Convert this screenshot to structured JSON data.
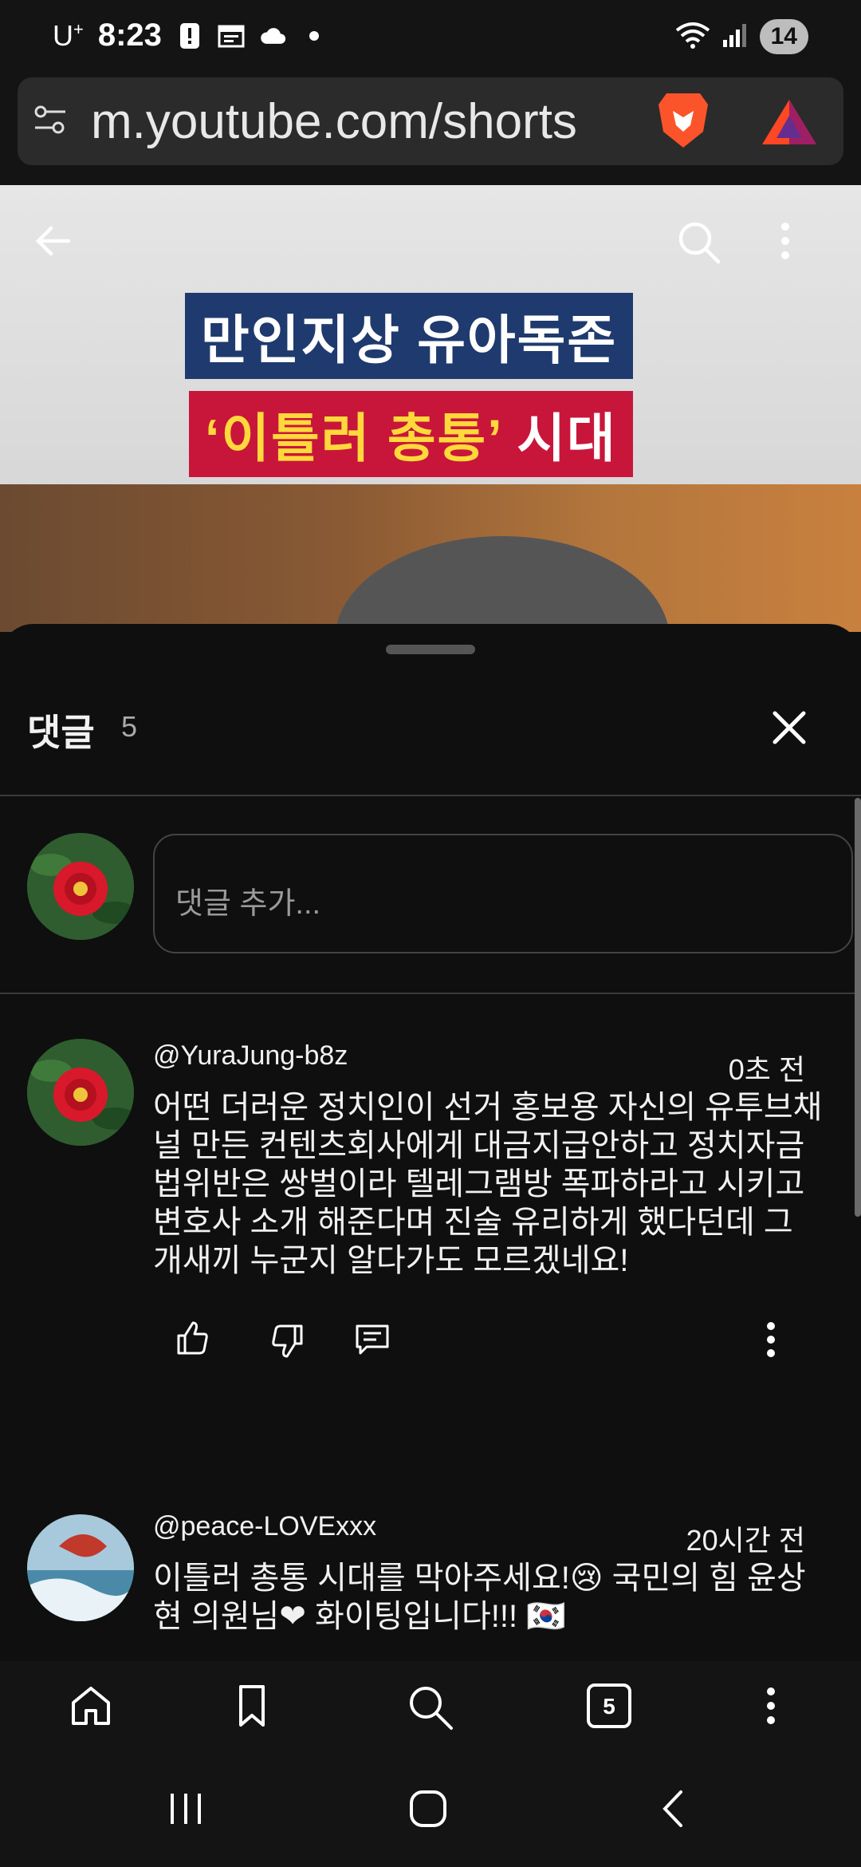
{
  "status_bar": {
    "carrier": "U",
    "carrier_sup": "+",
    "time": "8:23",
    "battery": "14"
  },
  "browser": {
    "url": "m.youtube.com/shorts",
    "icons": [
      "tune-icon",
      "brave-lion-icon",
      "brave-rewards-icon"
    ]
  },
  "video": {
    "caption_line1": "만인지상 유아독존",
    "caption_line2_quoted": "‘이틀러 총통’",
    "caption_line2_rest": " 시대",
    "icons": [
      "back-arrow-icon",
      "search-icon",
      "more-vert-icon"
    ]
  },
  "comments_panel": {
    "title": "댓글",
    "count": "5",
    "input_placeholder": "댓글 추가...",
    "comments": [
      {
        "handle": "@YuraJung-b8z",
        "time": "0초 전",
        "text": "어떤 더러운 정치인이 선거 홍보용 자신의 유투브채널 만든 컨텐츠회사에게 대금지급안하고 정치자금법위반은 쌍벌이라 텔레그램방 폭파하라고 시키고 변호사 소개 해준다며 진술 유리하게 했다던데 그 개새끼 누군지 알다가도 모르겠네요!"
      },
      {
        "handle": "@peace-LOVExxx",
        "time": "20시간 전",
        "text": "이틀러 총통 시대를 막아주세요!😢 국민의 힘 윤상현 의원님❤ 화이팅입니다!!! 🇰🇷"
      }
    ]
  },
  "browser_nav": {
    "tabs_count": "5",
    "icons": [
      "home-icon",
      "bookmark-icon",
      "search-icon",
      "tabs-icon",
      "more-vert-icon"
    ]
  },
  "system_nav": {
    "icons": [
      "recent-apps-icon",
      "home-circle-icon",
      "back-chevron-icon"
    ]
  },
  "colors": {
    "background": "#0f0f0f",
    "caption_blue": "#1f3a6e",
    "caption_red": "#c8163b",
    "caption_yellow": "#ffd93b"
  }
}
